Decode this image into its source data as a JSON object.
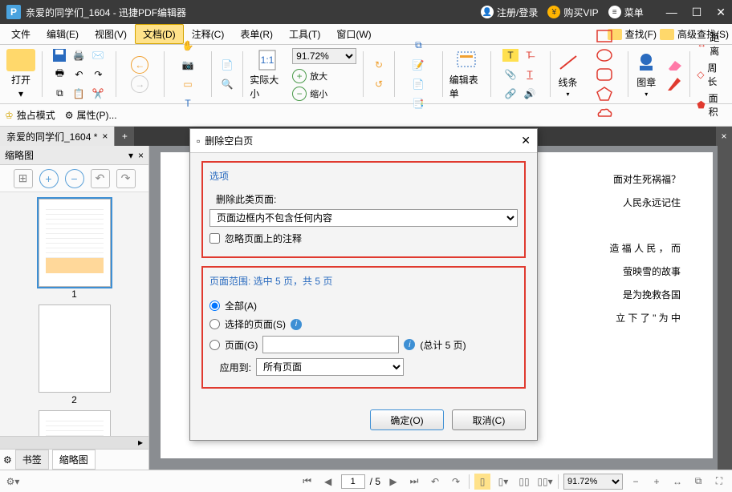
{
  "titlebar": {
    "app_icon_letter": "P",
    "title": "亲爱的同学们_1604  -  迅捷PDF编辑器",
    "register": "注册/登录",
    "buy_vip": "购买VIP",
    "menu": "菜单"
  },
  "menubar": {
    "items": [
      "文件",
      "编辑(E)",
      "视图(V)",
      "文档(D)",
      "注释(C)",
      "表单(R)",
      "工具(T)",
      "窗口(W)"
    ],
    "active_index": 3,
    "search": "查找(F)",
    "adv_search": "高级查找(S)"
  },
  "toolbar": {
    "open": "打开",
    "zoom_value": "91.72%",
    "actual_size": "实际大小",
    "zoom_in": "放大",
    "zoom_out": "缩小",
    "edit_form": "编辑表单",
    "lines": "线条",
    "stamp": "图章",
    "distance": "距离",
    "perimeter": "周长",
    "area": "面积"
  },
  "propbar": {
    "exclusive": "独占模式",
    "props": "属性(P)..."
  },
  "tab": {
    "name": "亲爱的同学们_1604 *"
  },
  "side": {
    "title": "缩略图",
    "page1": "1",
    "page2": "2",
    "bookmarks": "书签",
    "thumbs": "缩略图"
  },
  "document": {
    "lines": [
      "面对生死祸福？",
      "人民永远记住",
      "",
      "造 福 人 民 ， 而",
      "萤映雪的故事",
      "是为挽救各国",
      "立 下 了 \" 为 中"
    ]
  },
  "dialog": {
    "title": "删除空白页",
    "options_label": "选项",
    "delete_pages_label": "删除此类页面:",
    "delete_sel_value": "页面边框内不包含任何内容",
    "ignore_annot": "忽略页面上的注释",
    "range_label": "页面范围: 选中 5 页，共 5 页",
    "all": "全部(A)",
    "selected": "选择的页面(S)",
    "pages_radio": "页面(G)",
    "total_pages": "(总计 5 页)",
    "apply_to": "应用到:",
    "apply_to_value": "所有页面",
    "ok": "确定(O)",
    "cancel": "取消(C)"
  },
  "status": {
    "cur_page": "1",
    "total": "/ 5",
    "zoom": "91.72%"
  }
}
